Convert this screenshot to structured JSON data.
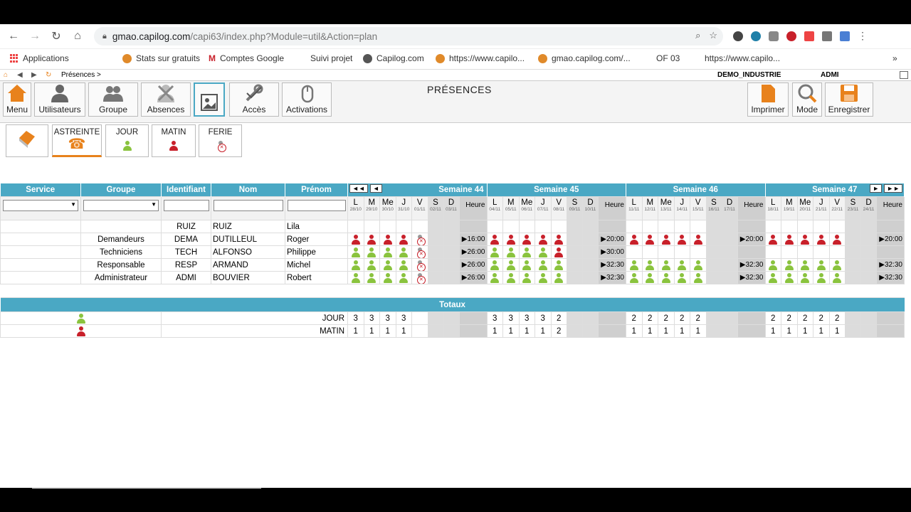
{
  "browser": {
    "url_host": "gmao.capilog.com",
    "url_path": "/capi63/index.php?Module=util&Action=plan",
    "bookmarks": [
      "Applications",
      "Stats sur gratuits",
      "Comptes Google",
      "Suivi projet",
      "Capilog.com",
      "https://www.capilo...",
      "gmao.capilog.com/...",
      "OF 03",
      "https://www.capilo..."
    ]
  },
  "app": {
    "path": "Présences >",
    "company": "DEMO_INDUSTRIE",
    "user": "ADMI",
    "title": "PRÉSENCES",
    "toolbar": [
      "Menu",
      "Utilisateurs",
      "Groupe",
      "Absences",
      "",
      "Accès",
      "Activations"
    ],
    "toolbar_right": [
      "Imprimer",
      "Mode",
      "Enregistrer"
    ],
    "filters": [
      "",
      "ASTREINTE",
      "JOUR",
      "MATIN",
      "FERIE"
    ],
    "columns": [
      "Service",
      "Groupe",
      "Identifiant",
      "Nom",
      "Prénom"
    ],
    "weeks": [
      "Semaine 44",
      "Semaine 45",
      "Semaine 46",
      "Semaine 47"
    ],
    "nav_first": "◄◄",
    "nav_prev": "◄",
    "nav_next": "►",
    "nav_last": "►►",
    "heure": "Heure",
    "days": [
      "L",
      "M",
      "Me",
      "J",
      "V",
      "S",
      "D"
    ],
    "dates": [
      [
        "28/10",
        "29/10",
        "30/10",
        "31/10",
        "01/11",
        "02/11",
        "03/11"
      ],
      [
        "04/11",
        "05/11",
        "06/11",
        "07/11",
        "08/11",
        "09/11",
        "10/11"
      ],
      [
        "11/11",
        "12/11",
        "13/11",
        "14/11",
        "15/11",
        "16/11",
        "17/11"
      ],
      [
        "18/11",
        "19/11",
        "20/11",
        "21/11",
        "22/11",
        "23/11",
        "24/11"
      ]
    ],
    "rows": [
      {
        "service": "",
        "groupe": "",
        "id": "RUIZ",
        "nom": "RUIZ",
        "prenom": "Lila",
        "hours": [
          "",
          "",
          "",
          ""
        ]
      },
      {
        "service": "",
        "groupe": "Demandeurs",
        "id": "DEMA",
        "nom": "DUTILLEUL",
        "prenom": "Roger",
        "hours": [
          "▶16:00",
          "▶20:00",
          "▶20:00",
          "▶20:00"
        ]
      },
      {
        "service": "",
        "groupe": "Techniciens",
        "id": "TECH",
        "nom": "ALFONSO",
        "prenom": "Philippe",
        "hours": [
          "▶26:00",
          "▶30:00",
          "",
          ""
        ]
      },
      {
        "service": "",
        "groupe": "Responsable",
        "id": "RESP",
        "nom": "ARMAND",
        "prenom": "Michel",
        "hours": [
          "▶26:00",
          "▶32:30",
          "▶32:30",
          "▶32:30"
        ]
      },
      {
        "service": "",
        "groupe": "Administrateur",
        "id": "ADMI",
        "nom": "BOUVIER",
        "prenom": "Robert",
        "hours": [
          "▶26:00",
          "▶32:30",
          "▶32:30",
          "▶32:30"
        ]
      }
    ],
    "presence": [
      [
        [
          "",
          "",
          "",
          "",
          "",
          "",
          ""
        ],
        [
          "",
          "",
          "",
          "",
          "",
          "",
          ""
        ],
        [
          "",
          "",
          "",
          "",
          "",
          "",
          ""
        ],
        [
          "",
          "",
          "",
          "",
          "",
          "",
          ""
        ]
      ],
      [
        [
          "R",
          "R",
          "R",
          "R",
          "X",
          "",
          ""
        ],
        [
          "R",
          "R",
          "R",
          "R",
          "R",
          "",
          ""
        ],
        [
          "R",
          "R",
          "R",
          "R",
          "R",
          "",
          ""
        ],
        [
          "R",
          "R",
          "R",
          "R",
          "R",
          "",
          ""
        ]
      ],
      [
        [
          "G",
          "G",
          "G",
          "G",
          "X",
          "",
          ""
        ],
        [
          "G",
          "G",
          "G",
          "G",
          "R",
          "",
          ""
        ],
        [
          "",
          "",
          "",
          "",
          "",
          "",
          ""
        ],
        [
          "",
          "",
          "",
          "",
          "",
          "",
          ""
        ]
      ],
      [
        [
          "G",
          "G",
          "G",
          "G",
          "X",
          "",
          ""
        ],
        [
          "G",
          "G",
          "G",
          "G",
          "G",
          "",
          ""
        ],
        [
          "G",
          "G",
          "G",
          "G",
          "G",
          "",
          ""
        ],
        [
          "G",
          "G",
          "G",
          "G",
          "G",
          "",
          ""
        ]
      ],
      [
        [
          "G",
          "G",
          "G",
          "G",
          "X",
          "",
          ""
        ],
        [
          "G",
          "G",
          "G",
          "G",
          "G",
          "",
          ""
        ],
        [
          "G",
          "G",
          "G",
          "G",
          "G",
          "",
          ""
        ],
        [
          "G",
          "G",
          "G",
          "G",
          "G",
          "",
          ""
        ]
      ]
    ],
    "totals_title": "Totaux",
    "totals": [
      {
        "label": "JOUR",
        "values": [
          [
            "3",
            "3",
            "3",
            "3",
            "",
            "",
            ""
          ],
          [
            "3",
            "3",
            "3",
            "3",
            "2",
            "",
            ""
          ],
          [
            "2",
            "2",
            "2",
            "2",
            "2",
            "",
            ""
          ],
          [
            "2",
            "2",
            "2",
            "2",
            "2",
            "",
            ""
          ]
        ]
      },
      {
        "label": "MATIN",
        "values": [
          [
            "1",
            "1",
            "1",
            "1",
            "",
            "",
            ""
          ],
          [
            "1",
            "1",
            "1",
            "1",
            "2",
            "",
            ""
          ],
          [
            "1",
            "1",
            "1",
            "1",
            "1",
            "",
            ""
          ],
          [
            "1",
            "1",
            "1",
            "1",
            "1",
            "",
            ""
          ]
        ]
      }
    ]
  }
}
